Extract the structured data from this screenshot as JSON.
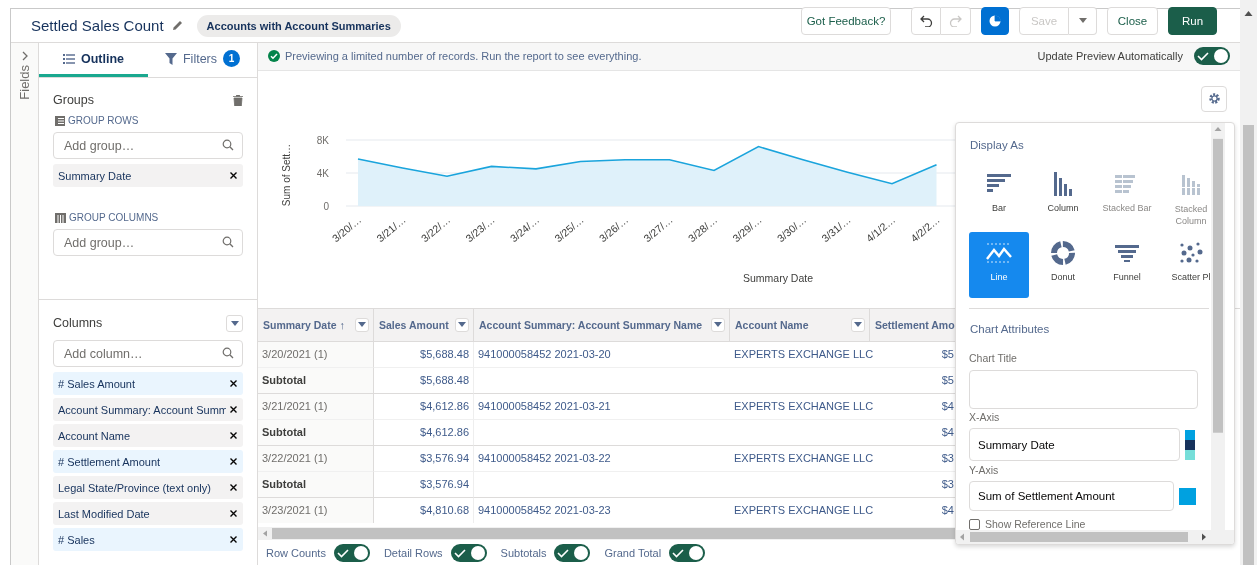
{
  "header": {
    "title": "Settled Sales Count",
    "report_type": "Accounts with Account Summaries",
    "feedback": "Got Feedback?",
    "chart_toggle": {
      "on": true
    },
    "save": {
      "label": "Save",
      "disabled": true
    },
    "close": "Close",
    "run": "Run"
  },
  "fields_tab": {
    "label": "Fields"
  },
  "outline": {
    "tabs": [
      {
        "label": "Outline",
        "selected": true
      },
      {
        "label": "Filters",
        "selected": false,
        "badge": "1"
      }
    ],
    "groups": {
      "title": "Groups",
      "rows_label": "GROUP ROWS",
      "rows_placeholder": "Add group…",
      "row_groups": [
        "Summary Date"
      ],
      "columns_label": "GROUP COLUMNS",
      "columns_placeholder": "Add group…"
    },
    "columns": {
      "title": "Columns",
      "placeholder": "Add column…",
      "items": [
        {
          "label": "# Sales Amount",
          "kind": "number"
        },
        {
          "label": "Account Summary: Account Summ",
          "kind": "text"
        },
        {
          "label": "Account Name",
          "kind": "text"
        },
        {
          "label": "# Settlement Amount",
          "kind": "number"
        },
        {
          "label": "Legal State/Province (text only)",
          "kind": "text"
        },
        {
          "label": "Last Modified Date",
          "kind": "text"
        },
        {
          "label": "# Sales",
          "kind": "number"
        }
      ]
    }
  },
  "preview": {
    "message": "Previewing a limited number of records. Run the report to see everything.",
    "auto_update": {
      "label": "Update Preview Automatically",
      "on": true
    }
  },
  "chart": {
    "chart_data": {
      "type": "area",
      "xlabel": "Summary Date",
      "ylabel": "Sum of Sett…",
      "categories": [
        "3/20/…",
        "3/21/…",
        "3/22/…",
        "3/23/…",
        "3/24/…",
        "3/25/…",
        "3/26/…",
        "3/27/…",
        "3/28/…",
        "3/29/…",
        "3/30/…",
        "3/31/…",
        "4/1/2…",
        "4/2/2…"
      ],
      "series": [
        {
          "color": "#1aa4dc",
          "values": [
            5700,
            4600,
            3600,
            4800,
            4500,
            5400,
            5600,
            5600,
            4300,
            7200,
            5600,
            4100,
            2700,
            5000
          ]
        }
      ],
      "ylim": [
        0,
        8000
      ],
      "yticks": [
        0,
        {
          "value": 4000,
          "label": "4K"
        },
        {
          "value": 8000,
          "label": "8K"
        }
      ]
    }
  },
  "table": {
    "columns": [
      {
        "label": "Summary Date",
        "sort": "↑"
      },
      {
        "label": "Sales Amount"
      },
      {
        "label": "Account Summary: Account Summary Name"
      },
      {
        "label": "Account Name"
      },
      {
        "label": "Settlement Amo"
      }
    ],
    "rows": [
      {
        "kind": "detail",
        "cells": [
          "3/20/2021 (1)",
          "$5,688.48",
          "941000058452 2021-03-20",
          "EXPERTS EXCHANGE LLC",
          "$5"
        ]
      },
      {
        "kind": "subtotal",
        "cells": [
          "Subtotal",
          "$5,688.48",
          "",
          "",
          "$5"
        ]
      },
      {
        "kind": "detail",
        "cells": [
          "3/21/2021 (1)",
          "$4,612.86",
          "941000058452 2021-03-21",
          "EXPERTS EXCHANGE LLC",
          "$4"
        ]
      },
      {
        "kind": "subtotal",
        "cells": [
          "Subtotal",
          "$4,612.86",
          "",
          "",
          "$4"
        ]
      },
      {
        "kind": "detail",
        "cells": [
          "3/22/2021 (1)",
          "$3,576.94",
          "941000058452 2021-03-22",
          "EXPERTS EXCHANGE LLC",
          "$3"
        ]
      },
      {
        "kind": "subtotal",
        "cells": [
          "Subtotal",
          "$3,576.94",
          "",
          "",
          "$3"
        ]
      },
      {
        "kind": "detail",
        "cells": [
          "3/23/2021 (1)",
          "$4,810.68",
          "941000058452 2021-03-23",
          "EXPERTS EXCHANGE LLC",
          "$4"
        ]
      }
    ]
  },
  "footer_toggles": [
    {
      "label": "Row Counts",
      "on": true
    },
    {
      "label": "Detail Rows",
      "on": true
    },
    {
      "label": "Subtotals",
      "on": true
    },
    {
      "label": "Grand Total",
      "on": true
    }
  ],
  "chart_settings": {
    "title": "Display As",
    "types": [
      {
        "label": "Bar",
        "kind": "bar",
        "selected": false,
        "disabled": false
      },
      {
        "label": "Column",
        "kind": "column",
        "selected": false,
        "disabled": false
      },
      {
        "label": "Stacked Bar",
        "kind": "stacked-bar",
        "selected": false,
        "disabled": true
      },
      {
        "label": "Stacked Column",
        "kind": "stacked-column",
        "selected": false,
        "disabled": true
      },
      {
        "label": "Line",
        "kind": "line",
        "selected": true,
        "disabled": false
      },
      {
        "label": "Donut",
        "kind": "donut",
        "selected": false,
        "disabled": false
      },
      {
        "label": "Funnel",
        "kind": "funnel",
        "selected": false,
        "disabled": false
      },
      {
        "label": "Scatter Pl",
        "kind": "scatter",
        "selected": false,
        "disabled": false
      }
    ],
    "attributes_title": "Chart Attributes",
    "chart_title_label": "Chart Title",
    "x_axis": {
      "label": "X-Axis",
      "value": "Summary Date",
      "palette": [
        {
          "color": "#00a1e0"
        },
        {
          "color": "#16325c"
        },
        {
          "color": "#76ded9"
        }
      ]
    },
    "y_axis": {
      "label": "Y-Axis",
      "value": "Sum of Settlement Amount",
      "color": "#00a1e0"
    },
    "reference_line": {
      "label": "Show Reference Line",
      "checked": false
    }
  }
}
